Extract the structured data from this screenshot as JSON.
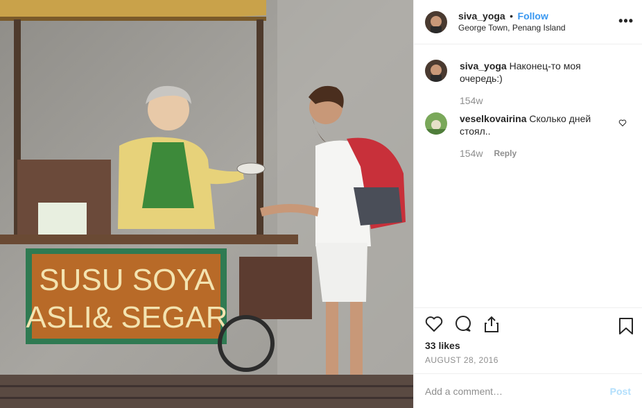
{
  "post": {
    "username": "siva_yoga",
    "follow_label": "Follow",
    "location": "George Town, Penang Island",
    "more_label": "•••"
  },
  "photo": {
    "sign_line1": "SUSU SOYA",
    "sign_line2": "ASLI& SEGAR"
  },
  "comments": [
    {
      "username": "siva_yoga",
      "text": "Наконец-то моя очередь:)",
      "age": "154w"
    },
    {
      "username": "veselkovairina",
      "text": "Сколько дней стоял..",
      "age": "154w",
      "reply_label": "Reply"
    }
  ],
  "likes": "33 likes",
  "date": "AUGUST 28, 2016",
  "add_comment": {
    "placeholder": "Add a comment…",
    "post_label": "Post"
  },
  "colors": {
    "follow": "#3897f0",
    "post_disabled": "#b2dffc",
    "muted": "#8e8e8e"
  }
}
